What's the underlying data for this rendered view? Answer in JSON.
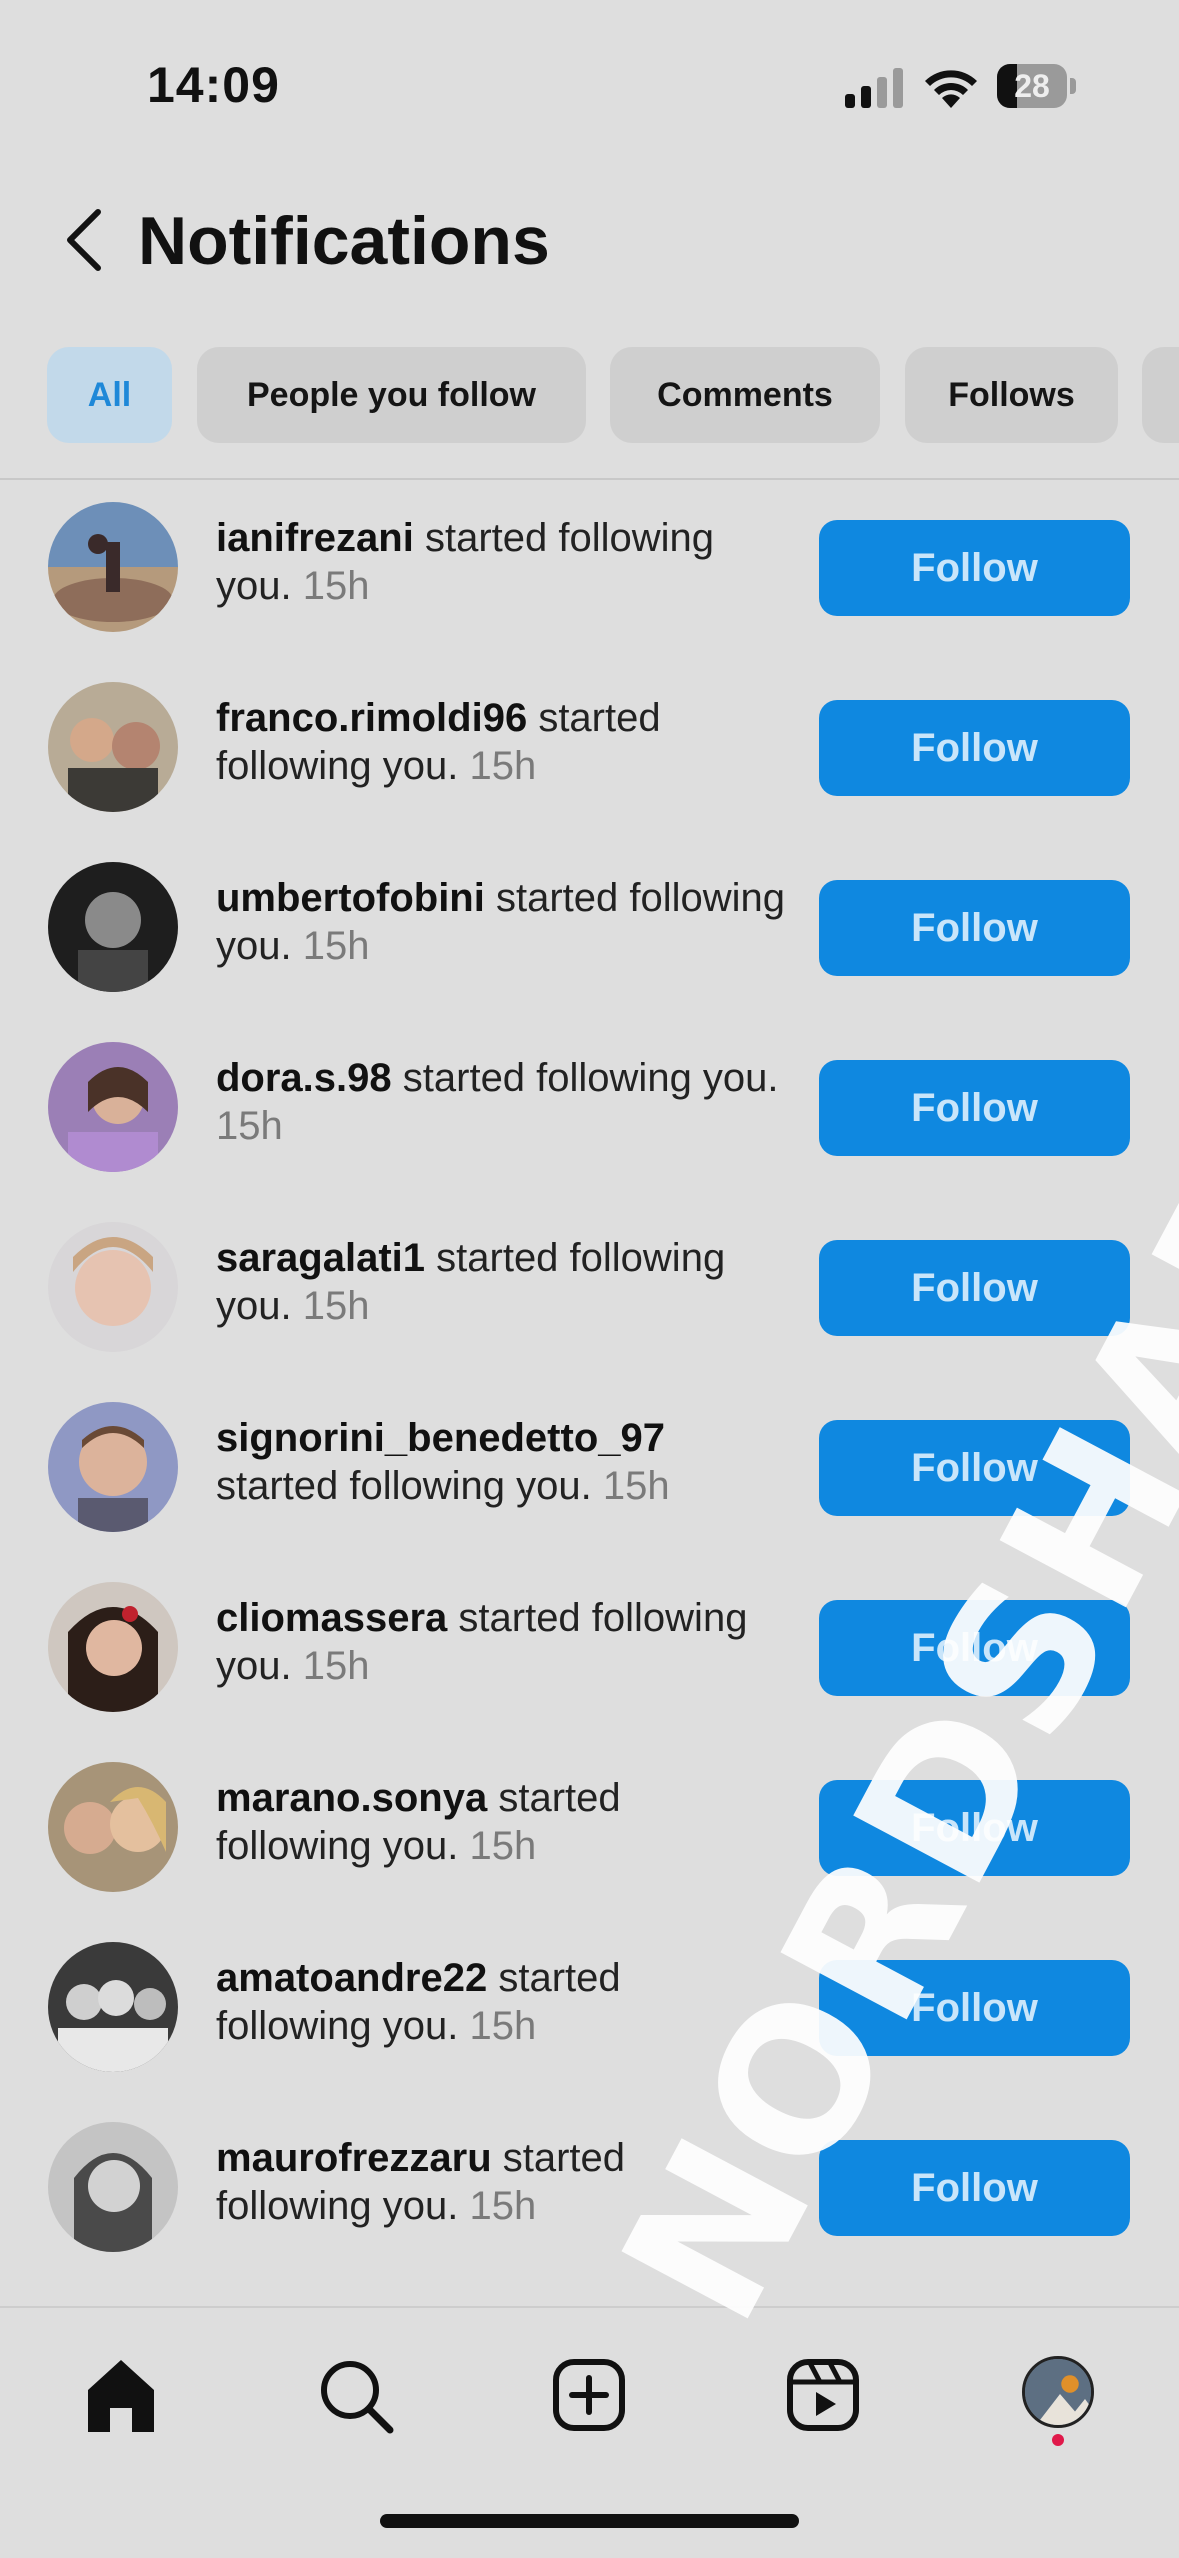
{
  "status_bar": {
    "time": "14:09",
    "battery_percent": "28",
    "battery_level": 0.28
  },
  "header": {
    "title": "Notifications"
  },
  "filters": [
    {
      "label": "All",
      "active": true
    },
    {
      "label": "People you follow",
      "active": false
    },
    {
      "label": "Comments",
      "active": false
    },
    {
      "label": "Follows",
      "active": false
    }
  ],
  "notifications": [
    {
      "username": "ianifrezani",
      "message": " started following you.",
      "time": " 15h",
      "button": "Follow"
    },
    {
      "username": "franco.rimoldi96",
      "message": " started following you.",
      "time": " 15h",
      "button": "Follow"
    },
    {
      "username": "umbertofobini",
      "message": " started following you.",
      "time": " 15h",
      "button": "Follow"
    },
    {
      "username": "dora.s.98",
      "message": " started following you.",
      "time": " 15h",
      "button": "Follow"
    },
    {
      "username": "saragalati1",
      "message": " started following you.",
      "time": " 15h",
      "button": "Follow"
    },
    {
      "username": "signorini_benedetto_97",
      "message": " started following you.",
      "time": " 15h",
      "button": "Follow"
    },
    {
      "username": "cliomassera",
      "message": " started following you.",
      "time": " 15h",
      "button": "Follow"
    },
    {
      "username": "marano.sonya",
      "message": " started following you.",
      "time": " 15h",
      "button": "Follow"
    },
    {
      "username": "amatoandre22",
      "message": " started following you.",
      "time": " 15h",
      "button": "Follow"
    },
    {
      "username": "maurofrezzaru",
      "message": " started following you.",
      "time": " 15h",
      "button": "Follow"
    }
  ],
  "tabbar": {
    "items": [
      "home-icon",
      "search-icon",
      "create-icon",
      "reels-icon",
      "profile-avatar"
    ]
  },
  "watermark": "NORDSHARK.COM"
}
